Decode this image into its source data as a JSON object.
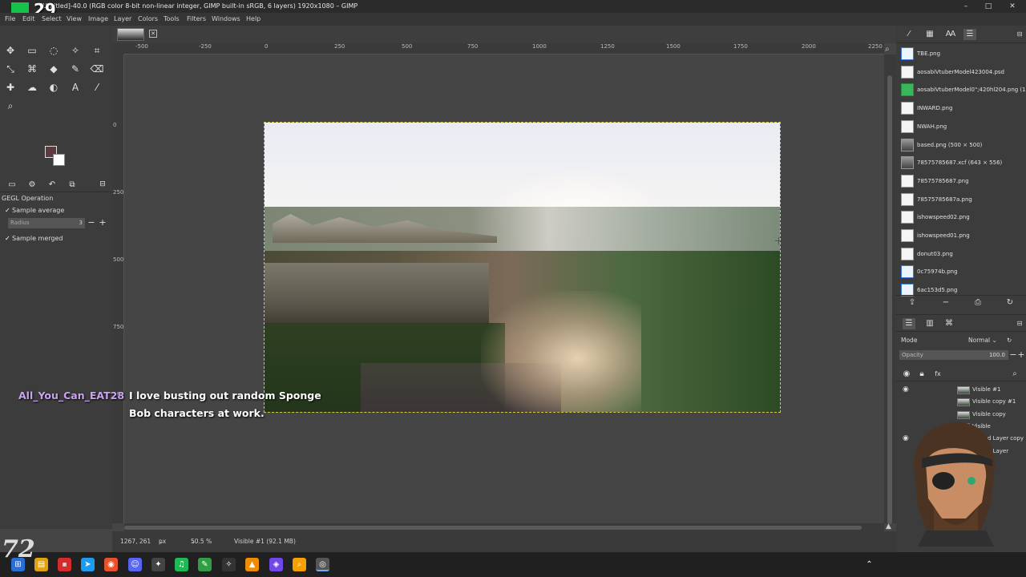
{
  "window": {
    "title": "[Untitled]-40.0 (RGB color 8-bit non-linear integer, GIMP built-in sRGB, 6 layers) 1920x1080 – GIMP",
    "overlay_number": "29",
    "controls": [
      "–",
      "□",
      "✕"
    ]
  },
  "menu": [
    "File",
    "Edit",
    "Select",
    "View",
    "Image",
    "Layer",
    "Colors",
    "Tools",
    "Filters",
    "Windows",
    "Help"
  ],
  "colors": {
    "foreground": "#5e3a3f",
    "background": "#ffffff",
    "selection_marching": "#d8c84a"
  },
  "tool_options": {
    "title": "GEGL Operation",
    "sample_average_label": "Sample average",
    "radius_label": "Radius",
    "radius_value": "3",
    "sample_merged_label": "Sample merged"
  },
  "ruler_h": [
    "-500",
    "-250",
    "0",
    "250",
    "500",
    "750",
    "1000",
    "1250",
    "1500",
    "1750",
    "2000",
    "2250"
  ],
  "ruler_v": [
    "0",
    "250",
    "500",
    "750",
    "1000"
  ],
  "status": {
    "coords": "1267, 261",
    "unit": "px",
    "zoom": "50.5 %",
    "info": "Visible #1 (92.1 MB)"
  },
  "images": [
    {
      "label": "TBE.png",
      "icon": "blue"
    },
    {
      "label": "aosabiVtuberModel423004.psd",
      "icon": "plain"
    },
    {
      "label": "aosabiVtuberModel0\";420hl204.png (1",
      "icon": "green"
    },
    {
      "label": "INWARD.png",
      "icon": "plain"
    },
    {
      "label": "NWAH.png",
      "icon": "plain"
    },
    {
      "label": "based.png (500 × 500)",
      "icon": "photo"
    },
    {
      "label": "78575785687.xcf (643 × 556)",
      "icon": "photo"
    },
    {
      "label": "78575785687.png",
      "icon": "plain"
    },
    {
      "label": "78575785687a.png",
      "icon": "plain"
    },
    {
      "label": "ishowspeed02.png",
      "icon": "plain"
    },
    {
      "label": "ishowspeed01.png",
      "icon": "plain"
    },
    {
      "label": "donut03.png",
      "icon": "plain"
    },
    {
      "label": "0c75974b.png",
      "icon": "blue"
    },
    {
      "label": "6ac153d5.png",
      "icon": "blue"
    }
  ],
  "layers_panel": {
    "mode_label": "Mode",
    "mode_value": "Normal",
    "opacity_label": "Opacity",
    "opacity_value": "100.0",
    "layers": [
      {
        "name": "Visible #1",
        "visible": true
      },
      {
        "name": "Visible copy #1",
        "visible": false
      },
      {
        "name": "Visible copy",
        "visible": false
      },
      {
        "name": "Visible",
        "visible": false
      },
      {
        "name": "Pasted Layer copy",
        "visible": true
      },
      {
        "name": "Pasted Layer",
        "visible": false
      }
    ]
  },
  "chat": {
    "username": "All_You_Can_EAT28",
    "message": "I love busting out random Sponge Bob characters at work."
  }
}
